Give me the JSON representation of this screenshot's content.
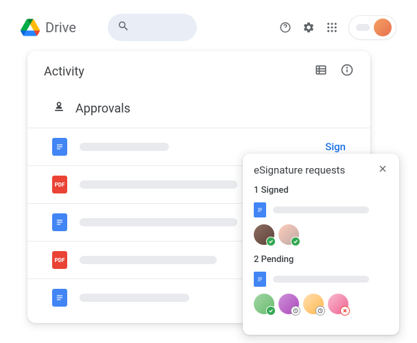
{
  "header": {
    "app_name": "Drive",
    "search_placeholder": "Search"
  },
  "activity": {
    "title": "Activity",
    "section_label": "Approvals",
    "sign_action": "Sign",
    "files": [
      {
        "type": "doc",
        "placeholder_width": 130,
        "has_sign": true
      },
      {
        "type": "pdf",
        "placeholder_width": 230,
        "has_sign": false
      },
      {
        "type": "doc",
        "placeholder_width": 230,
        "has_sign": false
      },
      {
        "type": "pdf",
        "placeholder_width": 200,
        "has_sign": false
      },
      {
        "type": "doc",
        "placeholder_width": 160,
        "has_sign": false
      }
    ]
  },
  "popup": {
    "title": "eSignature requests",
    "groups": [
      {
        "label": "1 Signed",
        "avatars": [
          {
            "cls": "av1",
            "badge": "check"
          },
          {
            "cls": "av2",
            "badge": "check"
          }
        ]
      },
      {
        "label": "2 Pending",
        "avatars": [
          {
            "cls": "av3",
            "badge": "check"
          },
          {
            "cls": "av4",
            "badge": "clock"
          },
          {
            "cls": "av5",
            "badge": "clock"
          },
          {
            "cls": "av6",
            "badge": "cross"
          }
        ]
      }
    ]
  },
  "icons": {
    "pdf_label": "PDF"
  }
}
